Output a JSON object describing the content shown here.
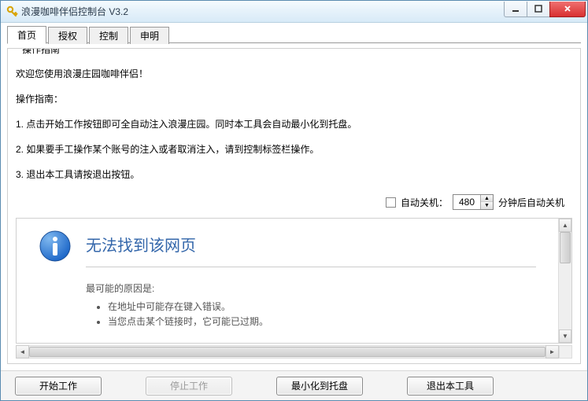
{
  "window": {
    "title": "浪漫咖啡伴侣控制台 V3.2"
  },
  "tabs": [
    {
      "label": "首页"
    },
    {
      "label": "授权"
    },
    {
      "label": "控制"
    },
    {
      "label": "申明"
    }
  ],
  "guide": {
    "legend": "操作指南",
    "welcome": "欢迎您使用浪漫庄园咖啡伴侣！",
    "heading": "操作指南：",
    "steps": [
      "1. 点击开始工作按钮即可全自动注入浪漫庄园。同时本工具会自动最小化到托盘。",
      "2. 如果要手工操作某个账号的注入或者取消注入，请到控制标签栏操作。",
      "3. 退出本工具请按退出按钮。"
    ]
  },
  "shutdown": {
    "checkbox_label": "自动关机：",
    "minutes": "480",
    "suffix": "分钟后自动关机"
  },
  "error_page": {
    "title": "无法找到该网页",
    "cause_heading": "最可能的原因是:",
    "causes": [
      "在地址中可能存在键入错误。",
      "当您点击某个链接时，它可能已过期。"
    ]
  },
  "footer": {
    "start": "开始工作",
    "stop": "停止工作",
    "minimize": "最小化到托盘",
    "exit": "退出本工具"
  }
}
